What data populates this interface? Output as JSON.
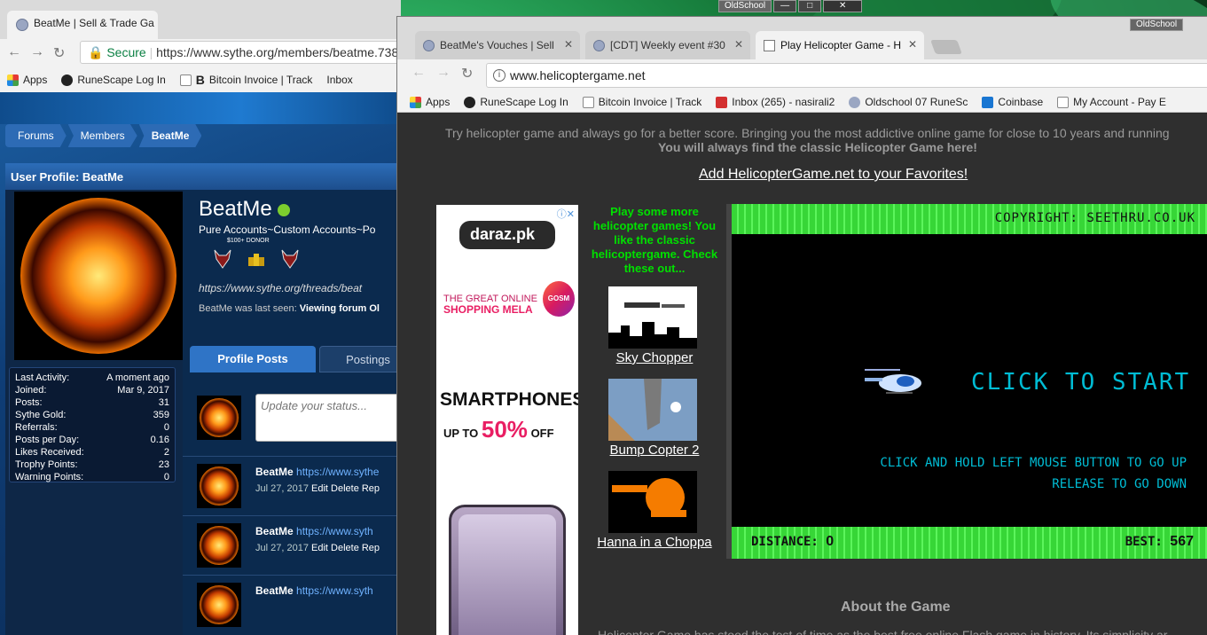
{
  "desktop": {
    "top_label": "OldSchool"
  },
  "back_window": {
    "tab_title": "BeatMe | Sell & Trade Ga",
    "address_secure": "Secure",
    "address_url": "https://www.sythe.org/members/beatme.738",
    "bookmarks": [
      "Apps",
      "RuneScape Log In",
      "Bitcoin Invoice | Track",
      "Inbox"
    ],
    "breadcrumbs": [
      "Forums",
      "Members",
      "BeatMe"
    ],
    "profile_header": "User Profile: BeatMe",
    "username": "BeatMe",
    "user_title": "Pure Accounts~Custom Accounts~Po",
    "donor_label": "$100+ DONOR",
    "profile_link": "https://www.sythe.org/threads/beat",
    "last_seen_prefix": "BeatMe was last seen:",
    "last_seen_value": "Viewing forum Ol",
    "stats": [
      {
        "label": "Last Activity:",
        "value": "A moment ago"
      },
      {
        "label": "Joined:",
        "value": "Mar 9, 2017"
      },
      {
        "label": "Posts:",
        "value": "31"
      },
      {
        "label": "Sythe Gold:",
        "value": "359"
      },
      {
        "label": "Referrals:",
        "value": "0"
      },
      {
        "label": "Posts per Day:",
        "value": "0.16"
      },
      {
        "label": "Likes Received:",
        "value": "2"
      },
      {
        "label": "Trophy Points:",
        "value": "23"
      },
      {
        "label": "Warning Points:",
        "value": "0"
      }
    ],
    "tabs": [
      "Profile Posts",
      "Postings"
    ],
    "status_placeholder": "Update your status...",
    "posts": [
      {
        "author": "BeatMe",
        "link": "https://www.sythe",
        "date": "Jul 27, 2017",
        "actions": "Edit Delete Rep"
      },
      {
        "author": "BeatMe",
        "link": "https://www.syth",
        "date": "Jul 27, 2017",
        "actions": "Edit Delete Rep"
      },
      {
        "author": "BeatMe",
        "link": "https://www.syth",
        "date": "",
        "actions": ""
      }
    ]
  },
  "front_window": {
    "os_label": "OldSchool",
    "tabs": [
      {
        "title": "BeatMe's Vouches | Sell"
      },
      {
        "title": "[CDT] Weekly event #30"
      },
      {
        "title": "Play Helicopter Game - H"
      }
    ],
    "address_url": "www.helicoptergame.net",
    "bookmarks": [
      "Apps",
      "RuneScape Log In",
      "Bitcoin Invoice | Track",
      "Inbox (265) - nasirali2",
      "Oldschool 07 RuneSc",
      "Coinbase",
      "My Account - Pay E"
    ],
    "intro_line1": "Try helicopter game and always go for a better score. Bringing you the most addictive online game for close to 10 years and running",
    "intro_line2": "You will always find the classic Helicopter Game here!",
    "favorites_link": "Add HelicopterGame.net to your Favorites!",
    "ad": {
      "brand": "daraz.pk",
      "mela_line1": "THE GREAT ONLINE",
      "mela_line2": "SHOPPING MELA",
      "balloon": "GOSM",
      "smartphones": "SMARTPHONES",
      "upto": "UP TO",
      "percent": "50%",
      "off": "OFF"
    },
    "games_heading": "Play some more helicopter games! You like the classic helicoptergame. Check these out...",
    "games": [
      "Sky Chopper",
      "Bump Copter 2",
      "Hanna in a Choppa"
    ],
    "game": {
      "copyright": "COPYRIGHT: SEETHRU.CO.UK",
      "click_to_start": "CLICK TO START",
      "instruction1": "CLICK AND HOLD LEFT MOUSE BUTTON TO GO UP",
      "instruction2": "RELEASE TO GO DOWN",
      "distance_label": "DISTANCE:",
      "distance_value": "0",
      "best_label": "BEST:",
      "best_value": "567"
    },
    "about_title": "About the Game",
    "about_text": "Helicopter Game has stood the test of time as the best free online Flash game in history. Its simplicity ar"
  }
}
